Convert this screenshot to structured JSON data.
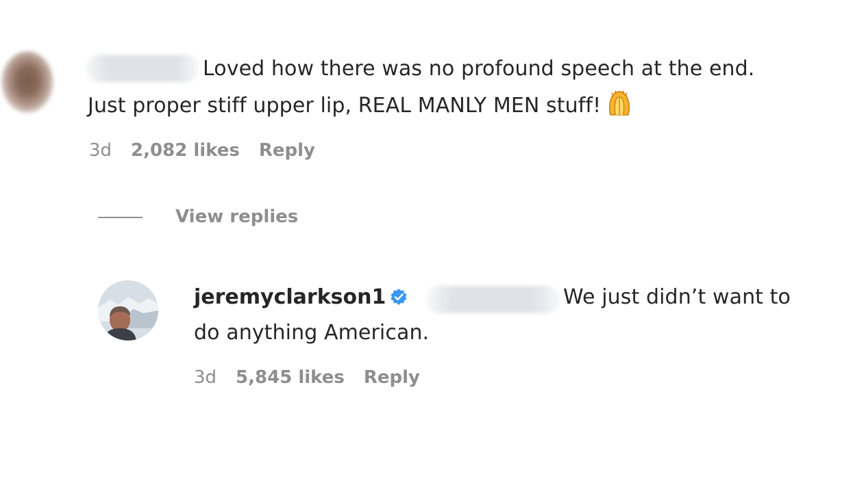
{
  "comments": [
    {
      "text_line1": "Loved how there was no profound speech at the end.",
      "text_line2": "Just proper stiff upper lip, REAL MANLY MEN stuff!",
      "emoji": "raising-hands-emoji",
      "time": "3d",
      "likes": "2,082 likes",
      "reply_label": "Reply",
      "view_replies_label": "View replies"
    }
  ],
  "reply": {
    "username": "jeremyclarkson1",
    "verified": true,
    "text_line1": "We just didn’t want to",
    "text_line2": "do anything American.",
    "time": "3d",
    "likes": "5,845 likes",
    "reply_label": "Reply"
  },
  "colors": {
    "text": "#262626",
    "meta": "#8e8e8e",
    "verified": "#3897f0"
  }
}
